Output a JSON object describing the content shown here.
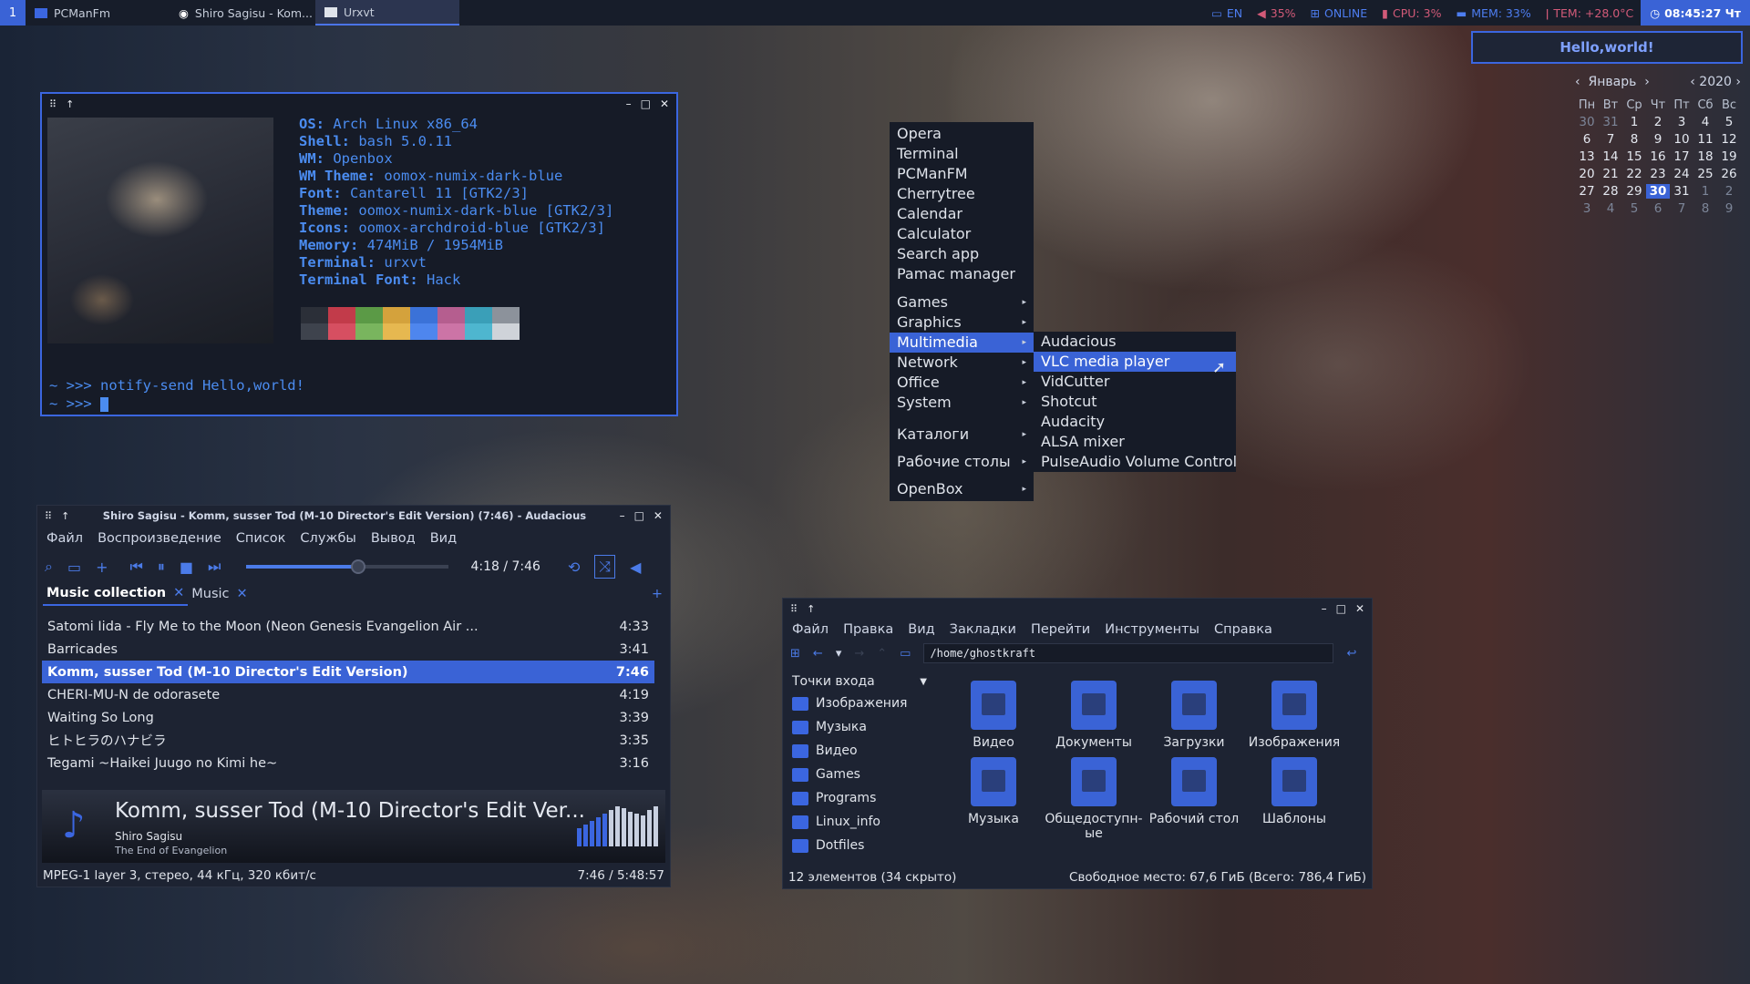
{
  "panel": {
    "workspace": "1",
    "tasks": [
      {
        "label": "PCManFm"
      },
      {
        "label": "Shiro Sagisu - Kom..."
      },
      {
        "label": "Urxvt"
      }
    ],
    "tray": {
      "lang": "EN",
      "volume": "35%",
      "net": "ONLINE",
      "cpu": "CPU: 3%",
      "mem": "MEM: 33%",
      "temp": "TEM: +28.0°C",
      "clock": "08:45:27 Чт"
    }
  },
  "notification": {
    "text": "Hello,world!"
  },
  "calendar": {
    "month": "Январь",
    "year": "2020",
    "day_names": [
      "Пн",
      "Вт",
      "Ср",
      "Чт",
      "Пт",
      "Сб",
      "Вс"
    ],
    "weeks": [
      [
        "30",
        "31",
        "1",
        "2",
        "3",
        "4",
        "5"
      ],
      [
        "6",
        "7",
        "8",
        "9",
        "10",
        "11",
        "12"
      ],
      [
        "13",
        "14",
        "15",
        "16",
        "17",
        "18",
        "19"
      ],
      [
        "20",
        "21",
        "22",
        "23",
        "24",
        "25",
        "26"
      ],
      [
        "27",
        "28",
        "29",
        "30",
        "31",
        "1",
        "2"
      ],
      [
        "3",
        "4",
        "5",
        "6",
        "7",
        "8",
        "9"
      ]
    ],
    "today": "30"
  },
  "terminal": {
    "info": [
      {
        "k": "OS:",
        "v": "Arch Linux x86_64"
      },
      {
        "k": "Shell:",
        "v": "bash 5.0.11"
      },
      {
        "k": "WM:",
        "v": "Openbox"
      },
      {
        "k": "WM Theme:",
        "v": "oomox-numix-dark-blue"
      },
      {
        "k": "Font:",
        "v": "Cantarell 11 [GTK2/3]"
      },
      {
        "k": "Theme:",
        "v": "oomox-numix-dark-blue [GTK2/3]"
      },
      {
        "k": "Icons:",
        "v": "oomox-archdroid-blue [GTK2/3]"
      },
      {
        "k": "Memory:",
        "v": "474MiB / 1954MiB"
      },
      {
        "k": "Terminal:",
        "v": "urxvt"
      },
      {
        "k": "Terminal Font:",
        "v": "Hack"
      }
    ],
    "palette_top": [
      "#2b2f38",
      "#c23b4a",
      "#5b9a46",
      "#d4a23c",
      "#3b72d8",
      "#b55e8f",
      "#3a9fb8",
      "#8c929b"
    ],
    "palette_bottom": [
      "#3e434d",
      "#d64f61",
      "#79b55e",
      "#e6b850",
      "#4e86ee",
      "#cc74a6",
      "#4eb6cf",
      "#cfd3d9"
    ],
    "cmd1": "~ >>> notify-send Hello,world!",
    "cmd2": "~ >>> "
  },
  "menu": {
    "items": [
      "Opera",
      "Terminal",
      "PCManFM",
      "Cherrytree",
      "Calendar",
      "Calculator",
      "Search app",
      "Pamac manager"
    ],
    "groups": [
      "Games",
      "Graphics",
      "Multimedia",
      "Network",
      "Office",
      "System"
    ],
    "extra": [
      "Каталоги",
      "Рабочие столы"
    ],
    "last": "OpenBox",
    "submenu": [
      "Audacious",
      "VLC media player",
      "VidCutter",
      "Shotcut",
      "Audacity",
      "ALSA mixer",
      "PulseAudio Volume Control"
    ]
  },
  "audacious": {
    "title": "Shiro Sagisu - Komm, susser Tod (M-10 Director's Edit Version) (7:46) - Audacious",
    "menu": [
      "Файл",
      "Воспроизведение",
      "Список",
      "Службы",
      "Вывод",
      "Вид"
    ],
    "time": "4:18 / 7:46",
    "progress": 0.55,
    "tabs": [
      "Music collection",
      "Music"
    ],
    "playlist": [
      {
        "t": "Satomi Iida - Fly Me to the Moon (Neon Genesis Evangelion Air ...",
        "d": "4:33"
      },
      {
        "t": "Barricades",
        "d": "3:41"
      },
      {
        "t": "Komm, susser Tod (M-10 Director's Edit Version)",
        "d": "7:46"
      },
      {
        "t": "CHERI-MU-N de odorasete",
        "d": "4:19"
      },
      {
        "t": "Waiting So Long",
        "d": "3:39"
      },
      {
        "t": "ヒトヒラのハナビラ",
        "d": "3:35"
      },
      {
        "t": "Tegami ~Haikei Juugo no Kimi he~",
        "d": "3:16"
      }
    ],
    "np_title": "Komm, susser Tod (M-10 Director's Edit Ver...",
    "np_artist": "Shiro Sagisu",
    "np_album": "The End of Evangelion",
    "status_left": "MPEG-1 layer 3, стерео, 44 кГц, 320 кбит/с",
    "status_right": "7:46 / 5:48:57"
  },
  "pcmanfm": {
    "menu": [
      "Файл",
      "Правка",
      "Вид",
      "Закладки",
      "Перейти",
      "Инструменты",
      "Справка"
    ],
    "path": "/home/ghostkraft",
    "side_header": "Точки входа",
    "side": [
      "Изображения",
      "Музыка",
      "Видео",
      "Games",
      "Programs",
      "Linux_info",
      "Dotfiles"
    ],
    "icons": [
      "Видео",
      "Документы",
      "Загрузки",
      "Изображения",
      "Музыка",
      "Общедоступн-ые",
      "Рабочий стол",
      "Шаблоны"
    ],
    "status_left": "12 элементов (34 скрыто)",
    "status_right": "Свободное место: 67,6 ГиБ (Всего: 786,4 ГиБ)"
  }
}
